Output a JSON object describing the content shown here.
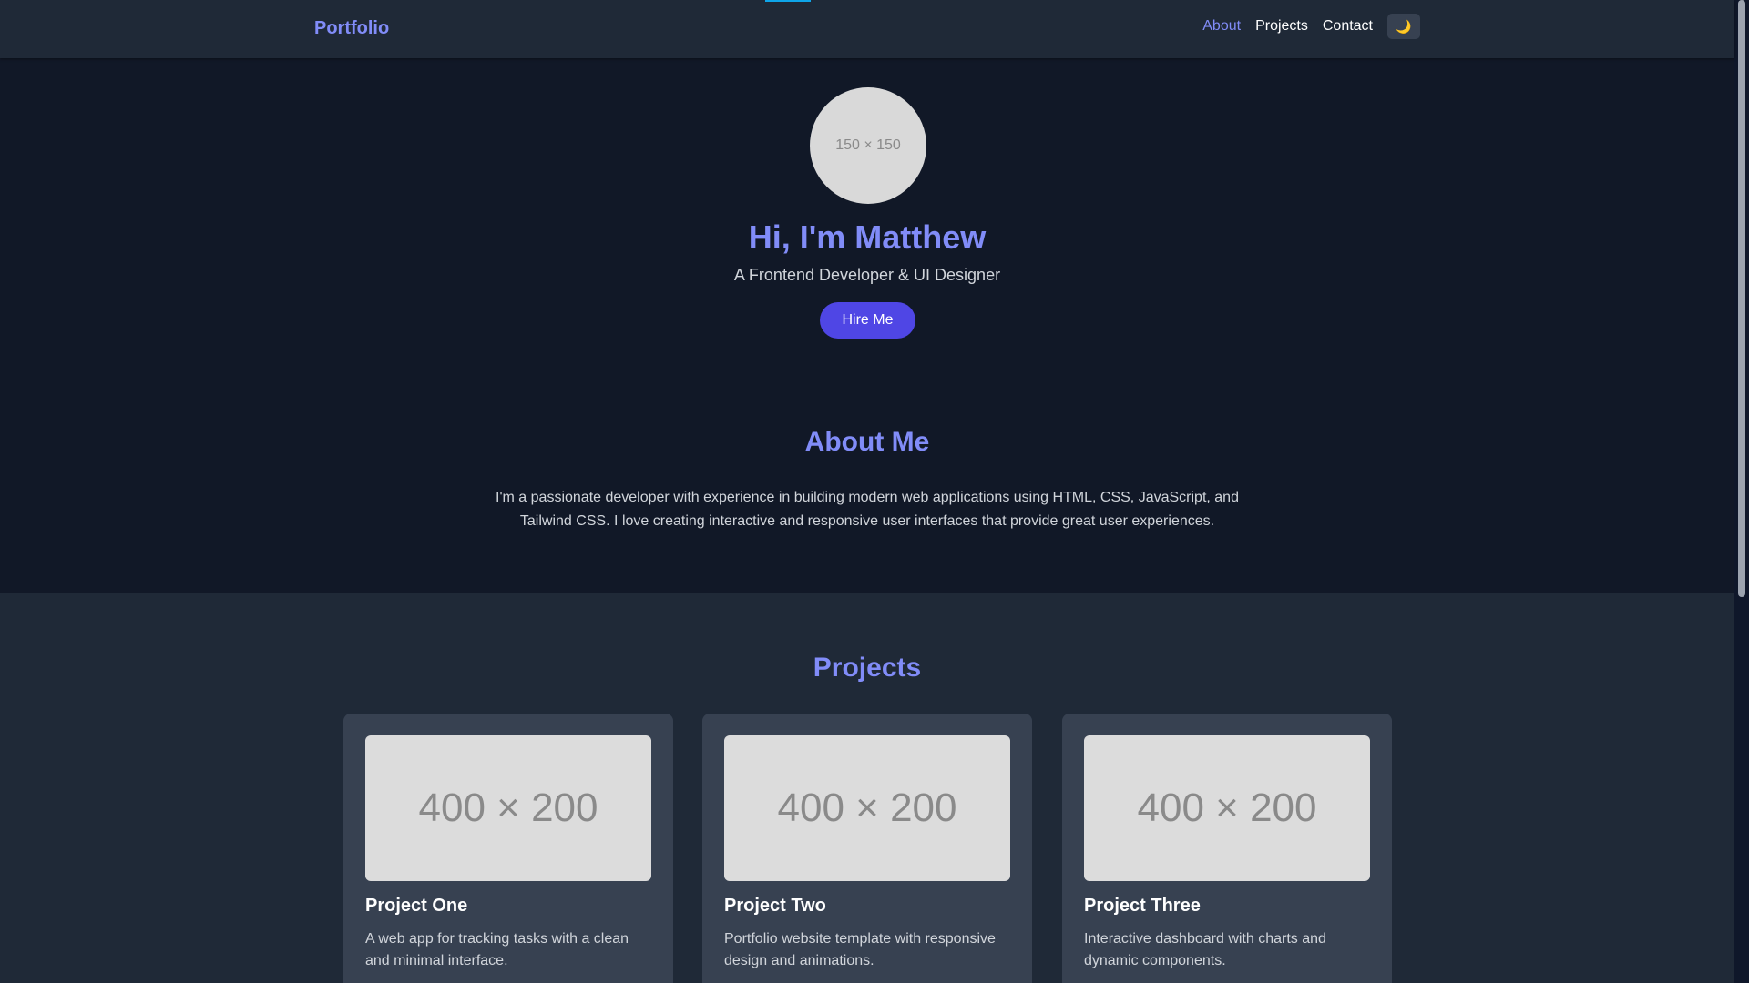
{
  "nav": {
    "brand": "Portfolio",
    "links": [
      "About",
      "Projects",
      "Contact"
    ],
    "active_link": "About",
    "theme_toggle_icon": "moon-icon"
  },
  "hero": {
    "avatar_text": "150 × 150",
    "title": "Hi, I'm Matthew",
    "subtitle": "A Frontend Developer & UI Designer",
    "cta_label": "Hire Me"
  },
  "about": {
    "title": "About Me",
    "text": "I'm a passionate developer with experience in building modern web applications using HTML, CSS, JavaScript, and Tailwind CSS. I love creating interactive and responsive user interfaces that provide great user experiences."
  },
  "projects": {
    "title": "Projects",
    "items": [
      {
        "image_text": "400 × 200",
        "title": "Project One",
        "description": "A web app for tracking tasks with a clean and minimal interface."
      },
      {
        "image_text": "400 × 200",
        "title": "Project Two",
        "description": "Portfolio website template with responsive design and animations."
      },
      {
        "image_text": "400 × 200",
        "title": "Project Three",
        "description": "Interactive dashboard with charts and dynamic components."
      }
    ]
  },
  "colors": {
    "accent": "#818cf8",
    "button": "#4f46e5",
    "background": "#111827",
    "surface": "#1f2937",
    "card": "#374151"
  }
}
